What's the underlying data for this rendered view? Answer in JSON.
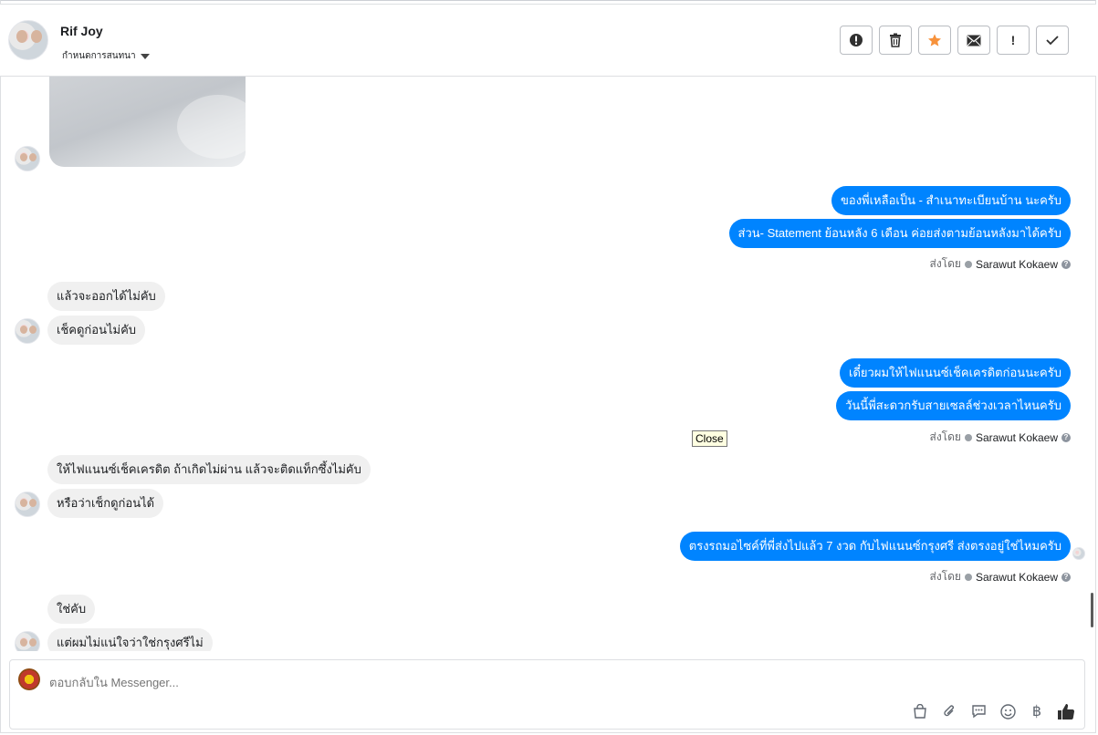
{
  "header": {
    "contact_name": "Rif Joy",
    "subtitle": "กำหนดการสนทนา",
    "actions": [
      {
        "name": "mark-spam-button",
        "glyph": "!",
        "icon": "alert-circle-icon"
      },
      {
        "name": "delete-button",
        "glyph": "🗑",
        "icon": "trash-icon"
      },
      {
        "name": "star-button",
        "glyph": "★",
        "icon": "star-icon"
      },
      {
        "name": "mark-unread-button",
        "glyph": "✉",
        "icon": "envelope-icon"
      },
      {
        "name": "mark-important-button",
        "glyph": "!",
        "icon": "exclamation-icon"
      },
      {
        "name": "mark-done-button",
        "glyph": "✓",
        "icon": "check-icon"
      }
    ]
  },
  "messages": {
    "out1": "ของพี่เหลือเป็น - สำเนาทะเบียนบ้าน นะครับ",
    "out2": "ส่วน- Statement ย้อนหลัง 6 เดือน ค่อยส่งตามย้อนหลังมาได้ครับ",
    "in1": "แล้วจะออกได้ไม่คับ",
    "in2": "เช็คดูก่อนไม่คับ",
    "out3": "เดี๋ยวผมให้ไฟแนนซ์เช็คเครดิตก่อนนะครับ",
    "out4": "วันนี้พี่สะดวกรับสายเซลล์ช่วงเวลาไหนครับ",
    "in3": "ให้ไฟแนนซ์เช็คเครดิต ถ้าเกิดไม่ผ่าน แล้วจะติดแท็กซึ้งไม่คับ",
    "in4": "หรือว่าเช็กดูก่อนได้",
    "out5": "ตรงรถมอไซค์ที่พี่ส่งไปแล้ว 7 งวด กับไฟแนนซ์กรุงศรี ส่งตรงอยู่ใช่ไหมครับ",
    "in5": "ใช่คับ",
    "in6": "แต่ผมไม่แน่ใจว่าใช่กรุงศรีไม่"
  },
  "sent_by": {
    "label": "ส่งโดย",
    "agent": "Sarawut Kokaew",
    "help": "?"
  },
  "tooltip": "Close",
  "composer": {
    "placeholder": "ตอบกลับใน Messenger...",
    "tools": [
      {
        "name": "saved-replies-icon",
        "glyph": "🛍"
      },
      {
        "name": "attachment-icon",
        "glyph": "📎"
      },
      {
        "name": "quick-reply-icon",
        "glyph": "💬"
      },
      {
        "name": "emoji-icon",
        "glyph": "☺"
      },
      {
        "name": "payment-baht-icon",
        "glyph": "฿"
      },
      {
        "name": "thumbs-up-icon",
        "glyph": "👍"
      }
    ]
  },
  "colors": {
    "outgoing_bubble": "#0084ff",
    "incoming_bubble": "#f0f0f0",
    "star": "#f7923b"
  }
}
